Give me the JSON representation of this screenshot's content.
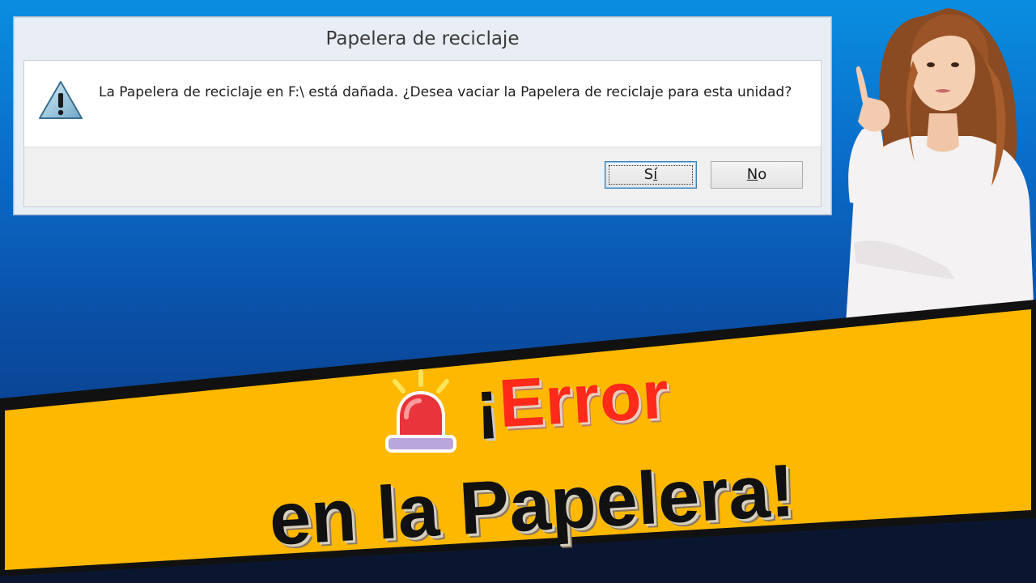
{
  "dialog": {
    "title": "Papelera de reciclaje",
    "message": "La Papelera de reciclaje en F:\\ está dañada. ¿Desea vaciar la Papelera de reciclaje para esta unidad?",
    "icon": "warning-icon",
    "buttons": {
      "yes_label_first": "S",
      "yes_label_mnemonic": "í",
      "no_label_mnemonic": "N",
      "no_label_rest": "o"
    }
  },
  "banner": {
    "line1_prefix": "¡",
    "line1_word": "Error",
    "line2": "en la Papelera!",
    "icon": "siren-icon",
    "background_color": "#ffb800",
    "error_color": "#ff2a1a"
  },
  "colors": {
    "background_top": "#0a8ee0",
    "background_bottom": "#0a2f72"
  }
}
